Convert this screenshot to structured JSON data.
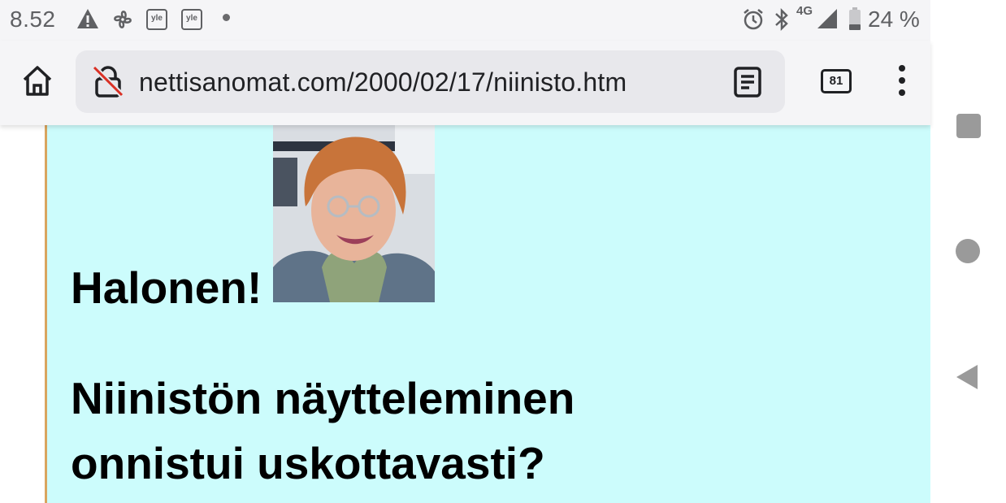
{
  "status_bar": {
    "time": "8.52",
    "notification_icons": [
      "warning-icon",
      "fan-icon",
      "yle-icon",
      "yle-icon",
      "dot-icon"
    ],
    "yle_label": "yle",
    "network": "4G",
    "battery": "24 %"
  },
  "browser": {
    "url": "nettisanomat.com/2000/02/17/niinisto.htm",
    "tab_count": "81"
  },
  "article": {
    "heading1": "Halonen!",
    "heading2": "Niinistön näytteleminen onnistui uskottavasti?"
  },
  "colors": {
    "page_background": "#ccfcfc",
    "column_border": "#d9a55f"
  }
}
